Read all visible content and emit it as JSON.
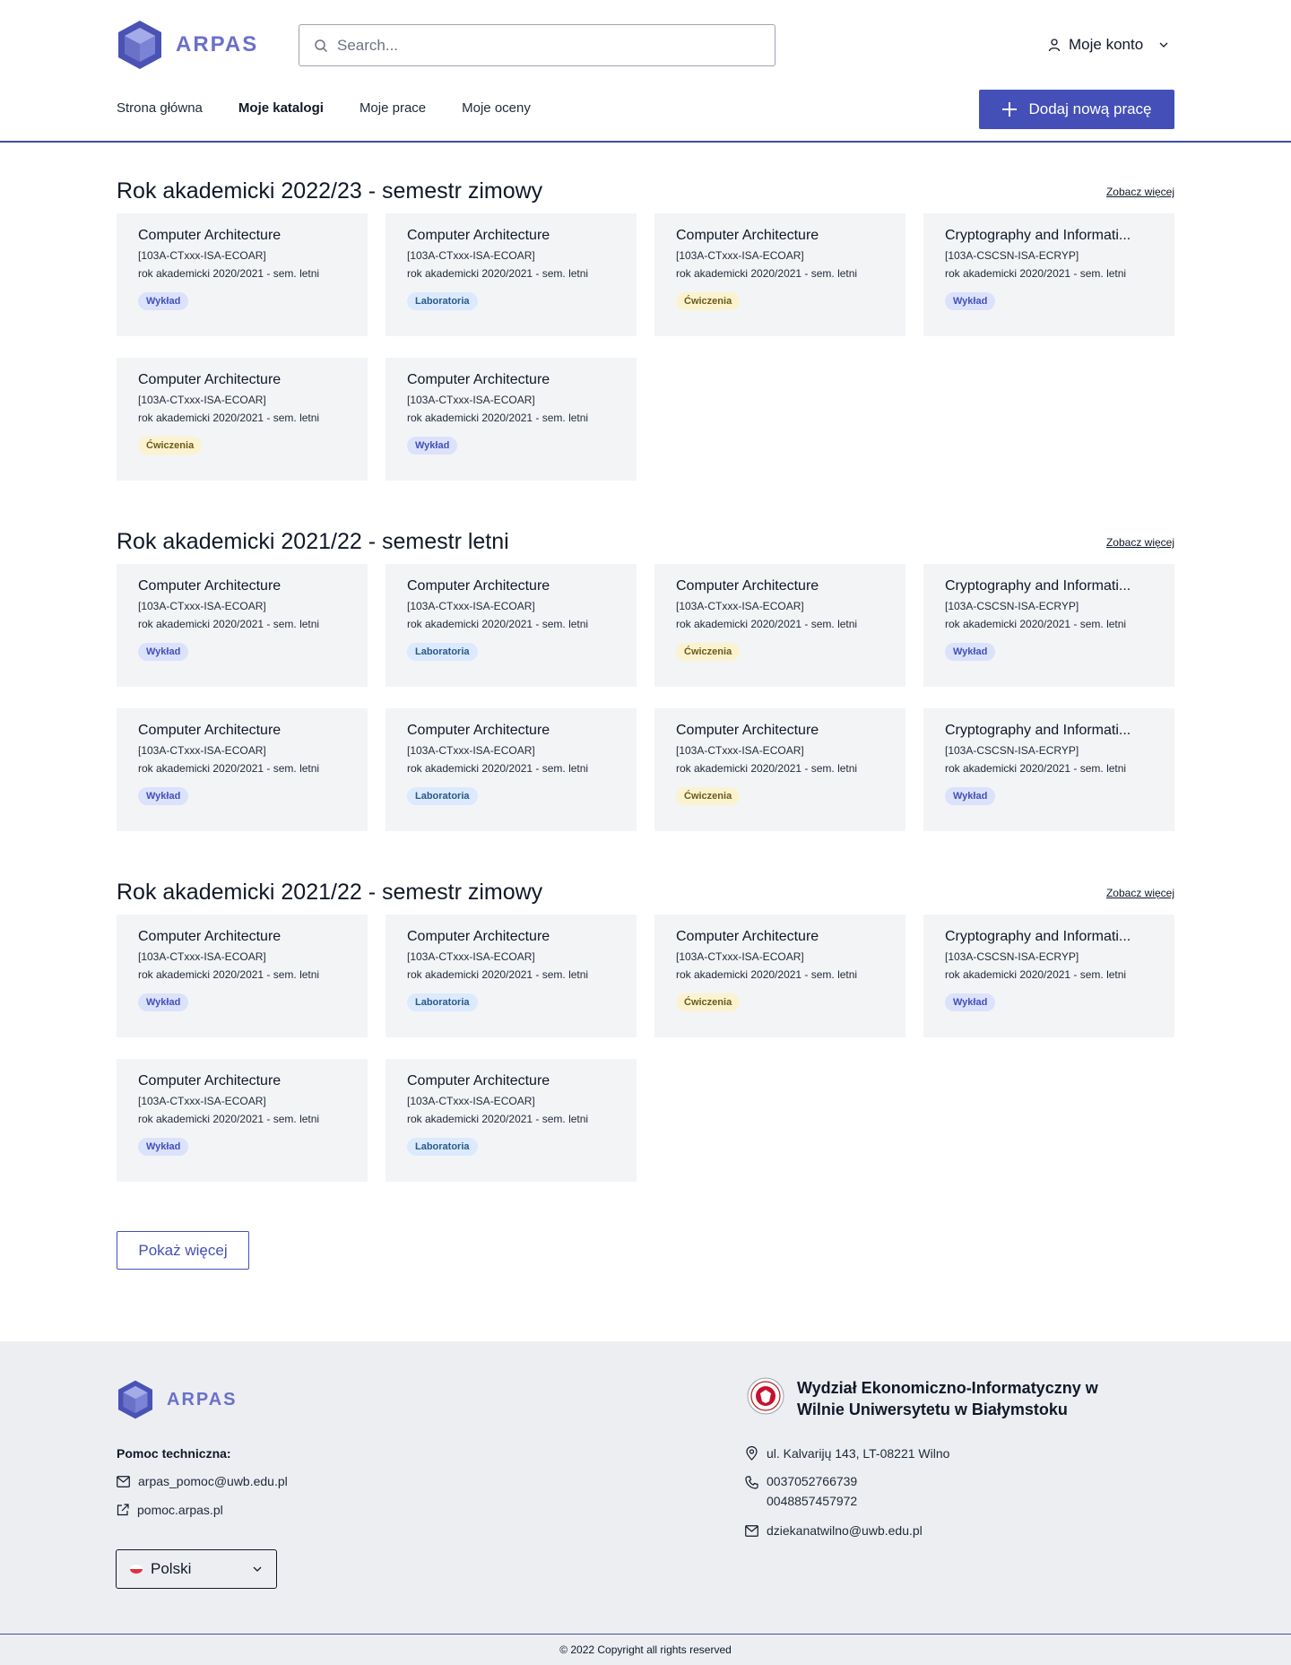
{
  "app": {
    "logo_text": "ARPAS"
  },
  "header": {
    "search_placeholder": "Search...",
    "account_label": "Moje konto",
    "nav": [
      "Strona główna",
      "Moje katalogi",
      "Moje prace",
      "Moje oceny"
    ],
    "add_button": "Dodaj nową pracę"
  },
  "sections": [
    {
      "title": "Rok akademicki 2022/23 - semestr zimowy",
      "see_more": "Zobacz więcej",
      "cards": [
        {
          "title": "Computer Architecture",
          "code": "[103A-CTxxx-ISA-ECOAR]",
          "year": "rok akademicki 2020/2021 - sem. letni",
          "badge": "Wykład",
          "type": "wyklad"
        },
        {
          "title": "Computer Architecture",
          "code": "[103A-CTxxx-ISA-ECOAR]",
          "year": "rok akademicki 2020/2021 - sem. letni",
          "badge": "Laboratoria",
          "type": "lab"
        },
        {
          "title": "Computer Architecture",
          "code": "[103A-CTxxx-ISA-ECOAR]",
          "year": "rok akademicki 2020/2021 - sem. letni",
          "badge": "Ćwiczenia",
          "type": "cw"
        },
        {
          "title": "Cryptography and Informati...",
          "code": "[103A-CSCSN-ISA-ECRYP]",
          "year": "rok akademicki 2020/2021 - sem. letni",
          "badge": "Wykład",
          "type": "wyklad"
        },
        {
          "title": "Computer Architecture",
          "code": "[103A-CTxxx-ISA-ECOAR]",
          "year": "rok akademicki 2020/2021 - sem. letni",
          "badge": "Ćwiczenia",
          "type": "cw"
        },
        {
          "title": "Computer Architecture",
          "code": "[103A-CTxxx-ISA-ECOAR]",
          "year": "rok akademicki 2020/2021 - sem. letni",
          "badge": "Wykład",
          "type": "wyklad"
        }
      ]
    },
    {
      "title": "Rok akademicki 2021/22 - semestr letni",
      "see_more": "Zobacz więcej",
      "cards": [
        {
          "title": "Computer Architecture",
          "code": "[103A-CTxxx-ISA-ECOAR]",
          "year": "rok akademicki 2020/2021 - sem. letni",
          "badge": "Wykład",
          "type": "wyklad"
        },
        {
          "title": "Computer Architecture",
          "code": "[103A-CTxxx-ISA-ECOAR]",
          "year": "rok akademicki 2020/2021 - sem. letni",
          "badge": "Laboratoria",
          "type": "lab"
        },
        {
          "title": "Computer Architecture",
          "code": "[103A-CTxxx-ISA-ECOAR]",
          "year": "rok akademicki 2020/2021 - sem. letni",
          "badge": "Ćwiczenia",
          "type": "cw"
        },
        {
          "title": "Cryptography and Informati...",
          "code": "[103A-CSCSN-ISA-ECRYP]",
          "year": "rok akademicki 2020/2021 - sem. letni",
          "badge": "Wykład",
          "type": "wyklad"
        },
        {
          "title": "Computer Architecture",
          "code": "[103A-CTxxx-ISA-ECOAR]",
          "year": "rok akademicki 2020/2021 - sem. letni",
          "badge": "Wykład",
          "type": "wyklad"
        },
        {
          "title": "Computer Architecture",
          "code": "[103A-CTxxx-ISA-ECOAR]",
          "year": "rok akademicki 2020/2021 - sem. letni",
          "badge": "Laboratoria",
          "type": "lab"
        },
        {
          "title": "Computer Architecture",
          "code": "[103A-CTxxx-ISA-ECOAR]",
          "year": "rok akademicki 2020/2021 - sem. letni",
          "badge": "Ćwiczenia",
          "type": "cw"
        },
        {
          "title": "Cryptography and Informati...",
          "code": "[103A-CSCSN-ISA-ECRYP]",
          "year": "rok akademicki 2020/2021 - sem. letni",
          "badge": "Wykład",
          "type": "wyklad"
        }
      ]
    },
    {
      "title": "Rok akademicki 2021/22 - semestr zimowy",
      "see_more": "Zobacz więcej",
      "cards": [
        {
          "title": "Computer Architecture",
          "code": "[103A-CTxxx-ISA-ECOAR]",
          "year": "rok akademicki 2020/2021 - sem. letni",
          "badge": "Wykład",
          "type": "wyklad"
        },
        {
          "title": "Computer Architecture",
          "code": "[103A-CTxxx-ISA-ECOAR]",
          "year": "rok akademicki 2020/2021 - sem. letni",
          "badge": "Laboratoria",
          "type": "lab"
        },
        {
          "title": "Computer Architecture",
          "code": "[103A-CTxxx-ISA-ECOAR]",
          "year": "rok akademicki 2020/2021 - sem. letni",
          "badge": "Ćwiczenia",
          "type": "cw"
        },
        {
          "title": "Cryptography and Informati...",
          "code": "[103A-CSCSN-ISA-ECRYP]",
          "year": "rok akademicki 2020/2021 - sem. letni",
          "badge": "Wykład",
          "type": "wyklad"
        },
        {
          "title": "Computer Architecture",
          "code": "[103A-CTxxx-ISA-ECOAR]",
          "year": "rok akademicki 2020/2021 - sem. letni",
          "badge": "Wykład",
          "type": "wyklad"
        },
        {
          "title": "Computer Architecture",
          "code": "[103A-CTxxx-ISA-ECOAR]",
          "year": "rok akademicki 2020/2021 - sem. letni",
          "badge": "Laboratoria",
          "type": "lab"
        }
      ]
    }
  ],
  "show_more": "Pokaż więcej",
  "footer": {
    "logo_text": "ARPAS",
    "help_label": "Pomoc techniczna:",
    "help_email": "arpas_pomoc@uwb.edu.pl",
    "help_site": "pomoc.arpas.pl",
    "language": "Polski",
    "university": "Wydział Ekonomiczno-Informatyczny w Wilnie Uniwersytetu w Białymstoku",
    "address": "ul. Kalvarijų 143, LT-08221 Wilno",
    "phone1": "0037052766739",
    "phone2": "0048857457972",
    "email": "dziekanatwilno@uwb.edu.pl",
    "copyright": "© 2022 Copyright all rights reserved"
  },
  "colors": {
    "accent": "#4450b8",
    "logo": "#6b70c9",
    "card_bg": "#f3f4f6",
    "footer_bg": "#eceef2"
  },
  "icons": [
    "logo-cube-icon",
    "search-icon",
    "user-icon",
    "chevron-down-icon",
    "plus-icon",
    "mail-icon",
    "external-link-icon",
    "map-pin-icon",
    "phone-icon",
    "flag-pl-icon",
    "university-seal-icon"
  ]
}
